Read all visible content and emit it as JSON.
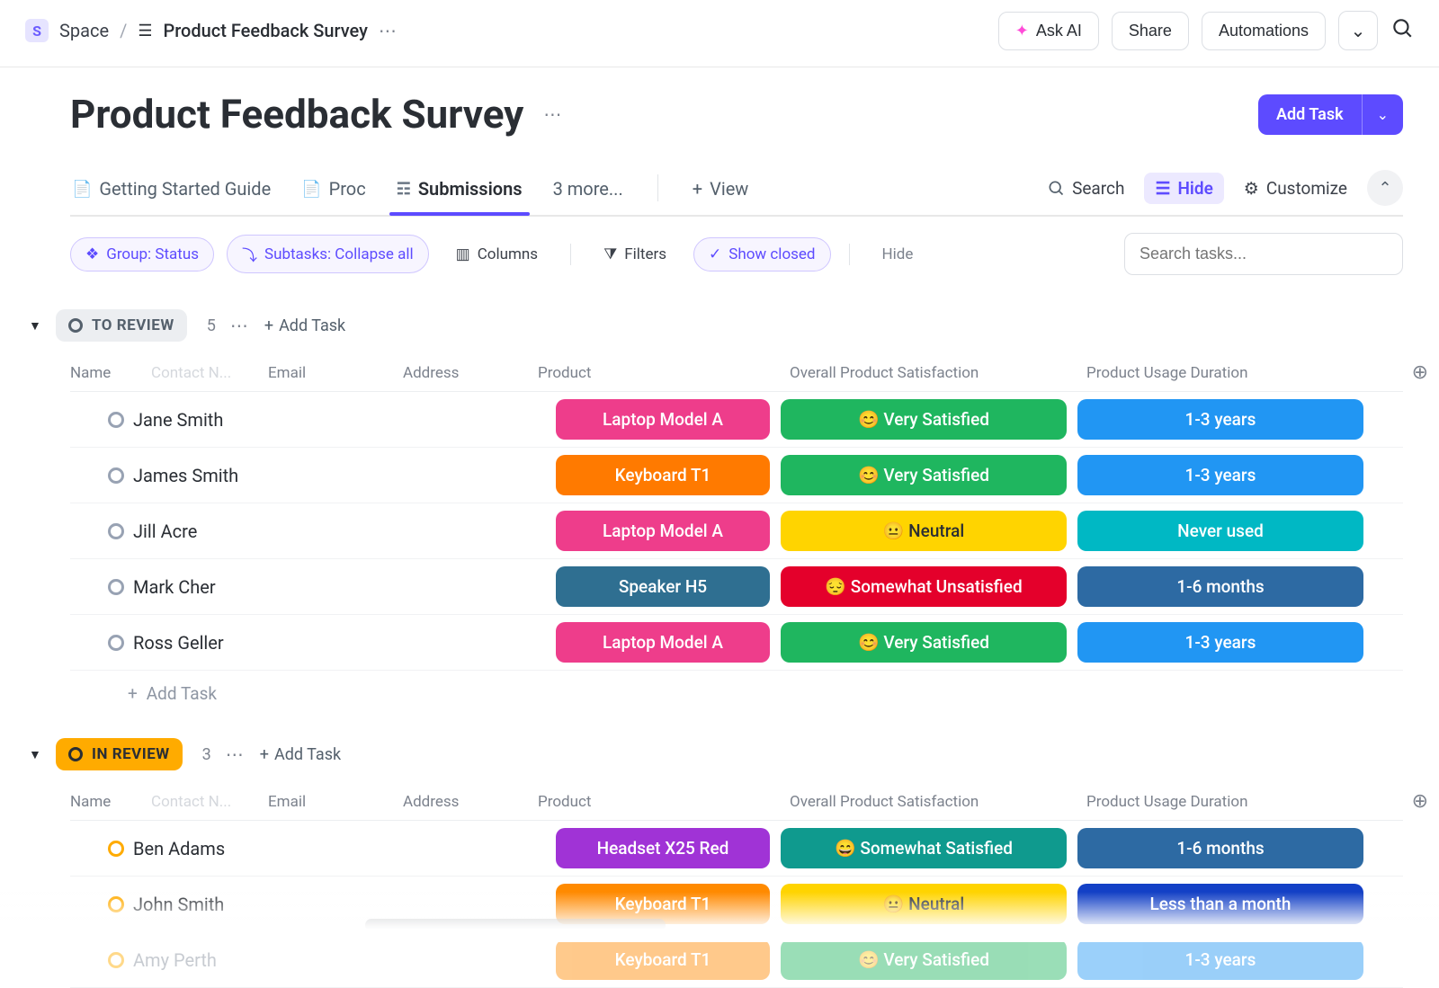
{
  "breadcrumb": {
    "space_badge": "S",
    "space_label": "Space",
    "page_label": "Product Feedback Survey"
  },
  "topbar": {
    "ask_ai": "Ask AI",
    "share": "Share",
    "automations": "Automations"
  },
  "page": {
    "title": "Product Feedback Survey",
    "add_task": "Add Task"
  },
  "tabs": {
    "getting_started": "Getting Started Guide",
    "proc_trunc": "Proc",
    "submissions": "Submissions",
    "more": "3 more...",
    "view": "View",
    "search": "Search",
    "hide": "Hide",
    "customize": "Customize"
  },
  "filters": {
    "group": "Group: Status",
    "subtasks": "Subtasks: Collapse all",
    "columns": "Columns",
    "filters": "Filters",
    "show_closed": "Show closed",
    "hide": "Hide",
    "search_placeholder": "Search tasks..."
  },
  "columns": {
    "name": "Name",
    "contact": "Contact N...",
    "email": "Email",
    "address": "Address",
    "product": "Product",
    "satisfaction": "Overall Product Satisfaction",
    "duration": "Product Usage Duration"
  },
  "colors": {
    "pink": "#ee3d8b",
    "orange": "#ff7a00",
    "steel": "#2f6f91",
    "purple": "#a033d6",
    "green": "#1fb65f",
    "yellow": "#ffd400",
    "red": "#e4002b",
    "teal": "#00b8c4",
    "blue": "#2196f3",
    "blue2": "#2d6aa3",
    "royal": "#1340c6",
    "coral": "#ff6b5b",
    "peach": "#ffd9c8",
    "tealDark": "#0f9a8e",
    "orange2": "#ff8a00"
  },
  "groups": [
    {
      "id": "to_review",
      "label": "TO REVIEW",
      "count": "5",
      "chip_class": "to-review",
      "rows": [
        {
          "name": "Jane Smith",
          "product": {
            "t": "Laptop Model A",
            "c": "pink"
          },
          "sat": {
            "t": "😊 Very Satisfied",
            "c": "green"
          },
          "dur": {
            "t": "1-3 years",
            "c": "blue"
          },
          "sliver": "coral"
        },
        {
          "name": "James Smith",
          "product": {
            "t": "Keyboard T1",
            "c": "orange"
          },
          "sat": {
            "t": "😊 Very Satisfied",
            "c": "green"
          },
          "dur": {
            "t": "1-3 years",
            "c": "blue"
          },
          "sliver": "coral"
        },
        {
          "name": "Jill Acre",
          "product": {
            "t": "Laptop Model A",
            "c": "pink"
          },
          "sat": {
            "t": "😐 Neutral",
            "c": "yellow",
            "dark": true
          },
          "dur": {
            "t": "Never used",
            "c": "teal"
          },
          "sliver": "peach"
        },
        {
          "name": "Mark Cher",
          "product": {
            "t": "Speaker H5",
            "c": "steel"
          },
          "sat": {
            "t": "😔 Somewhat Unsatisfied",
            "c": "red"
          },
          "dur": {
            "t": "1-6 months",
            "c": "blue2"
          },
          "sliver": "coral"
        },
        {
          "name": "Ross Geller",
          "product": {
            "t": "Laptop Model A",
            "c": "pink"
          },
          "sat": {
            "t": "😊 Very Satisfied",
            "c": "green"
          },
          "dur": {
            "t": "1-3 years",
            "c": "blue"
          },
          "sliver": "coral"
        }
      ],
      "add_label": "Add Task"
    },
    {
      "id": "in_review",
      "label": "IN REVIEW",
      "count": "3",
      "chip_class": "in-review",
      "rows": [
        {
          "name": "Ben Adams",
          "status": "amber",
          "product": {
            "t": "Headset X25 Red",
            "c": "purple"
          },
          "sat": {
            "t": "😄 Somewhat Satisfied",
            "c": "tealDark"
          },
          "dur": {
            "t": "1-6 months",
            "c": "blue2"
          },
          "sliver": "coral"
        },
        {
          "name": "John Smith",
          "status": "amber",
          "product": {
            "t": "Keyboard T1",
            "c": "orange2"
          },
          "sat": {
            "t": "😐 Neutral",
            "c": "yellow",
            "dark": true
          },
          "dur": {
            "t": "Less than a month",
            "c": "royal"
          },
          "sliver": "peach"
        },
        {
          "name": "Amy Perth",
          "status": "amber",
          "fade": true,
          "product": {
            "t": "Keyboard T1",
            "c": "orange2"
          },
          "sat": {
            "t": "😊 Very Satisfied",
            "c": "green"
          },
          "dur": {
            "t": "1-3 years",
            "c": "blue"
          },
          "sliver": "coral"
        }
      ]
    }
  ],
  "misc": {
    "add_task_inline": "Add Task"
  }
}
